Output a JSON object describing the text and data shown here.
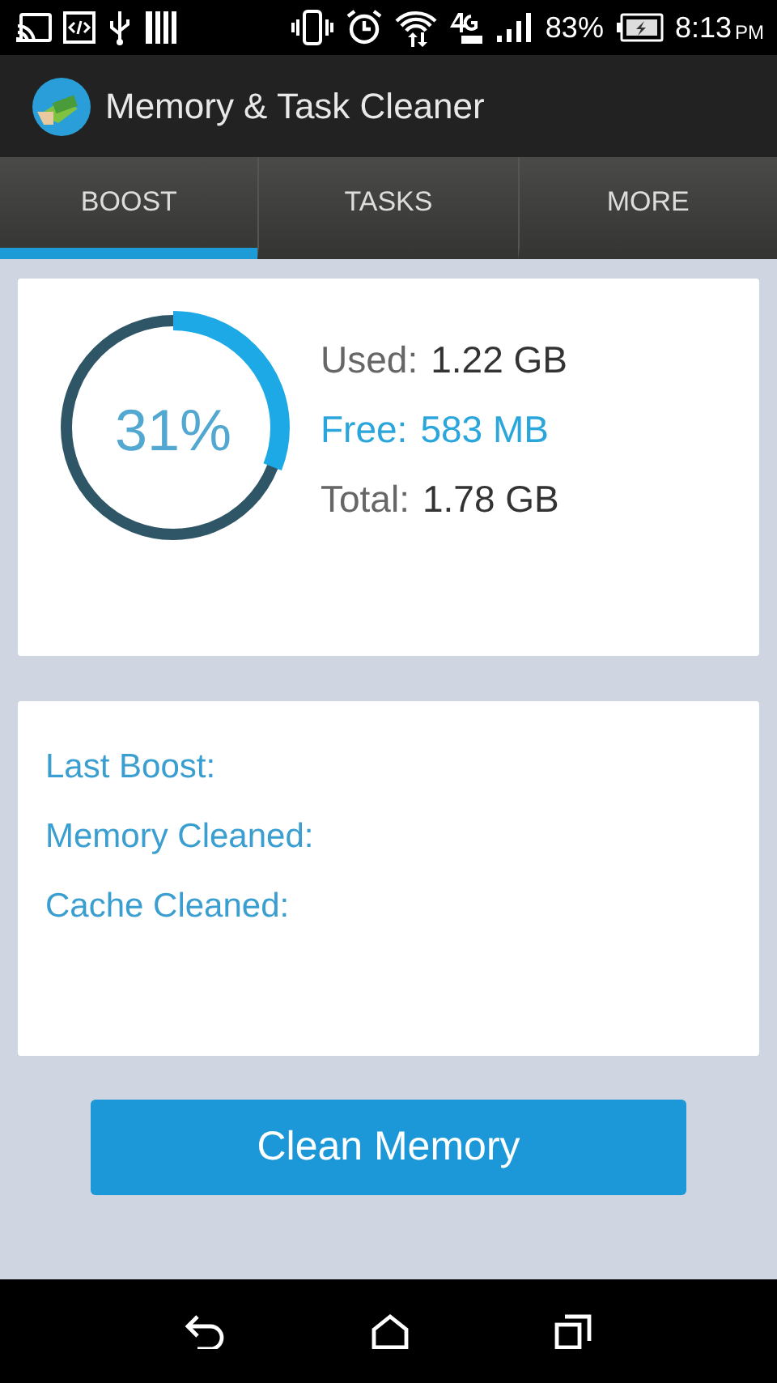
{
  "status_bar": {
    "battery": "83%",
    "time": "8:13",
    "ampm": "PM"
  },
  "app_bar": {
    "title": "Memory & Task Cleaner"
  },
  "tabs": [
    {
      "label": "BOOST",
      "selected": true
    },
    {
      "label": "TASKS",
      "selected": false
    },
    {
      "label": "MORE",
      "selected": false
    }
  ],
  "memory": {
    "percent": "31%",
    "stats": [
      {
        "label": "Used:",
        "value": "1.22 GB",
        "highlighted": false
      },
      {
        "label": "Free:",
        "value": "583 MB",
        "highlighted": true
      },
      {
        "label": "Total:",
        "value": "1.78 GB",
        "highlighted": false
      }
    ]
  },
  "history": [
    "Last Boost:",
    "Memory Cleaned:",
    "Cache Cleaned:"
  ],
  "clean_button": "Clean Memory"
}
